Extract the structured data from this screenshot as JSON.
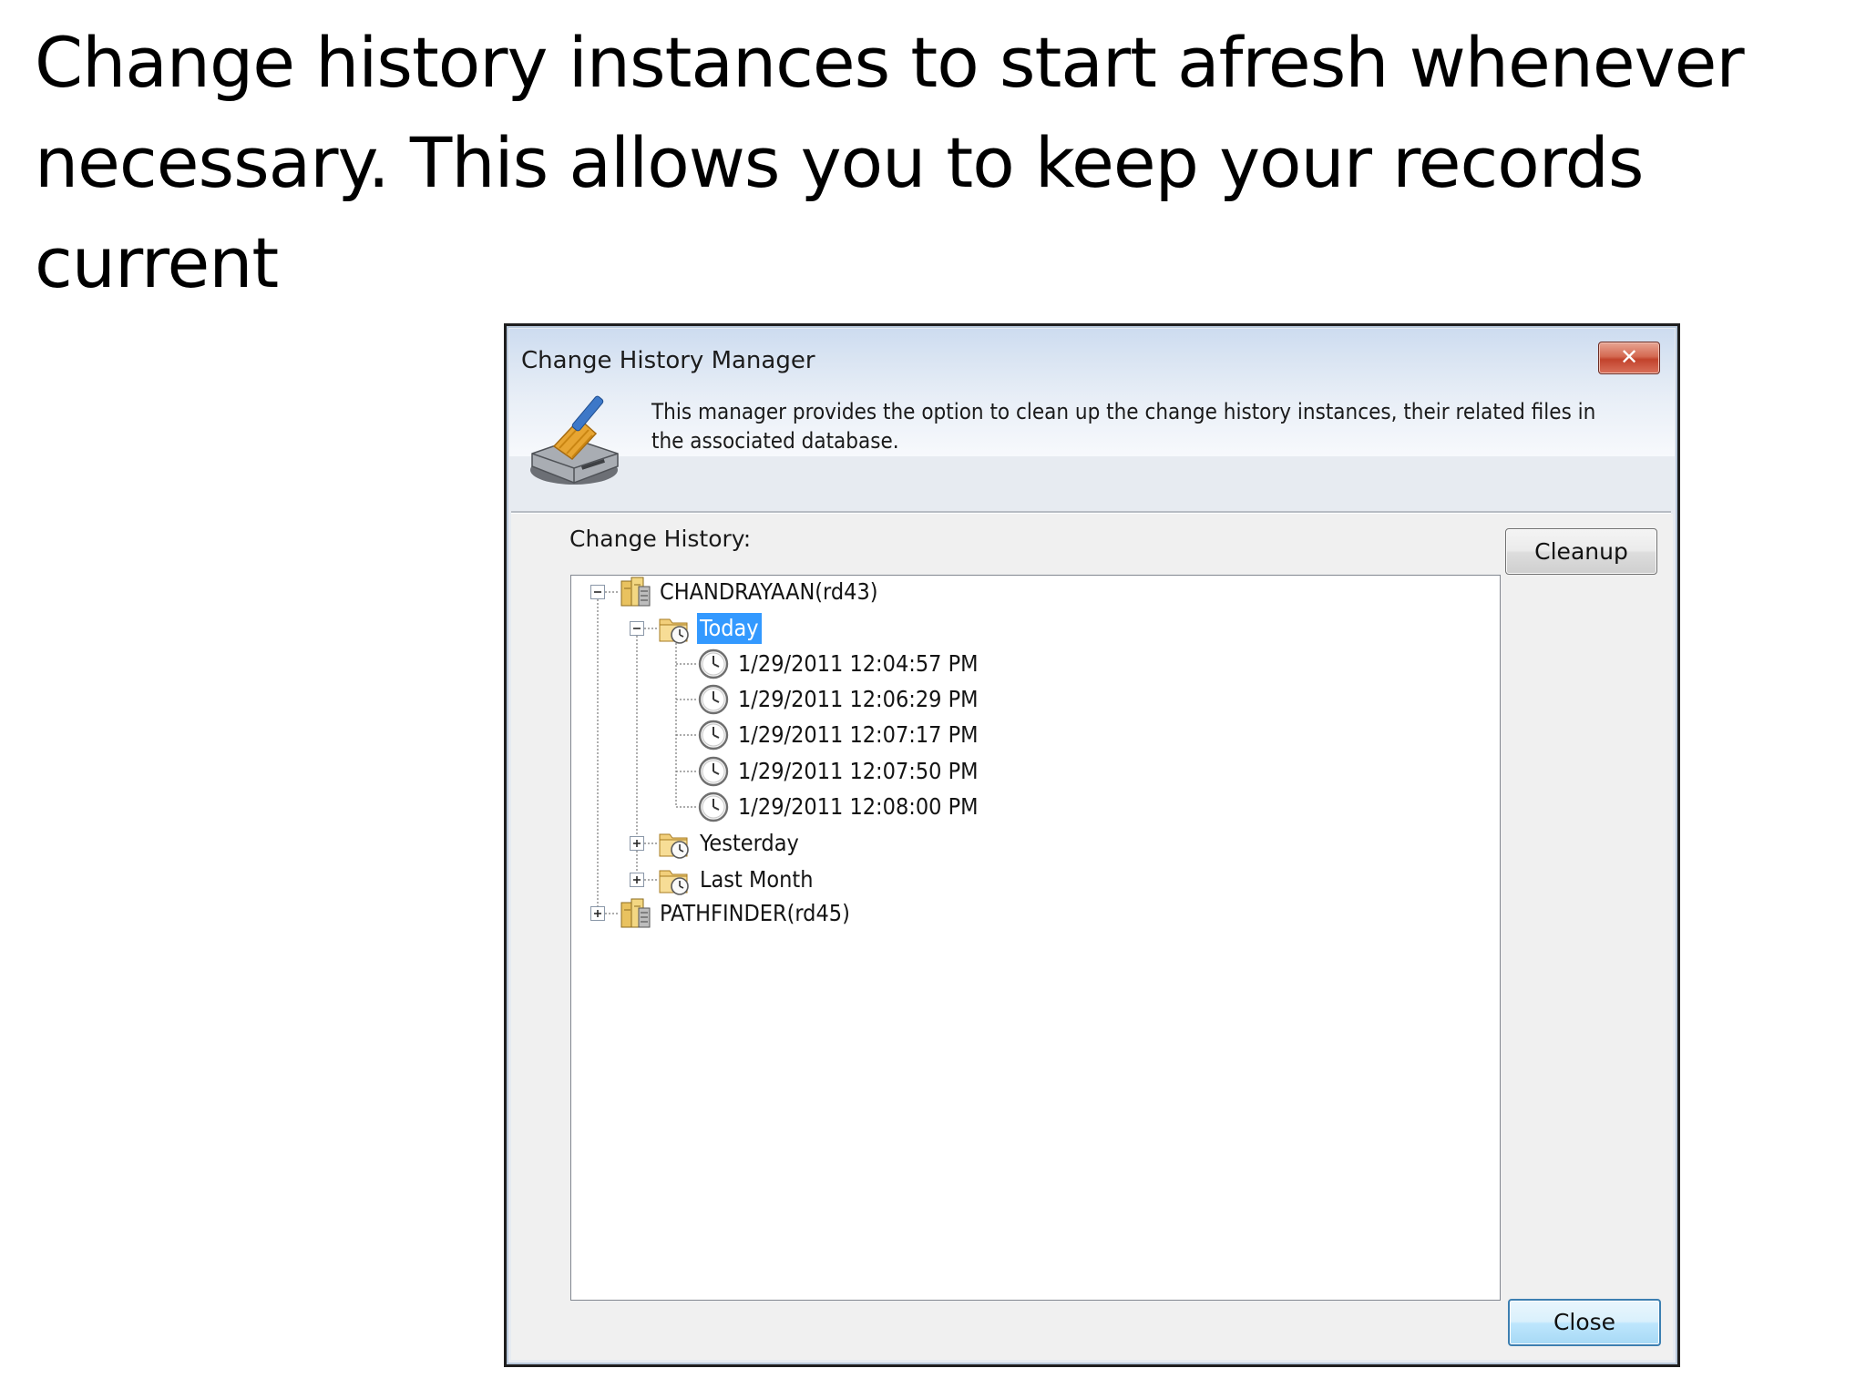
{
  "slide": {
    "text": "Change history instances to start afresh whenever necessary. This allows you to keep your records current"
  },
  "dialog": {
    "title": "Change History Manager",
    "close_glyph": "✕",
    "description": "This manager provides the option to clean up the change history instances, their related files in the associated database.",
    "change_history_label": "Change History:",
    "cleanup_label": "Cleanup",
    "close_label": "Close"
  },
  "tree": {
    "root1": "CHANDRAYAAN(rd43)",
    "today": "Today",
    "entries": [
      "1/29/2011 12:04:57 PM",
      "1/29/2011 12:06:29 PM",
      "1/29/2011 12:07:17 PM",
      "1/29/2011 12:07:50 PM",
      "1/29/2011 12:08:00 PM"
    ],
    "yesterday": "Yesterday",
    "last_month": "Last Month",
    "root2": "PATHFINDER(rd45)"
  },
  "icons": {
    "header": "broom-disk-icon",
    "server": "server-icon",
    "folder": "folder-clock-icon",
    "clock": "clock-icon",
    "expand": "plus-box-icon",
    "collapse": "minus-box-icon"
  },
  "colors": {
    "selection": "#3399ff",
    "close_button": "#c2432c",
    "title_gradient_top": "#cddcf0"
  }
}
